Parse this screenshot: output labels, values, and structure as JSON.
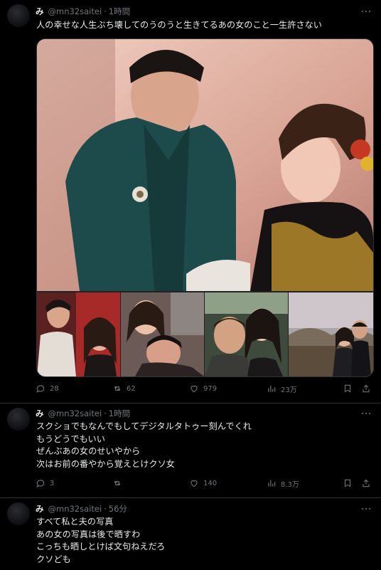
{
  "tweets": [
    {
      "name": "み",
      "handle": "@mn32saitei",
      "time": "1時間",
      "lines": [
        "人の幸せな人生ぶち壊してのうのうと生きてるあの女のこと一生許さない"
      ],
      "replies": "28",
      "retweets": "62",
      "likes": "979",
      "views": "23万"
    },
    {
      "name": "み",
      "handle": "@mn32saitei",
      "time": "1時間",
      "lines": [
        "スクショでもなんでもしてデジタルタトゥー刻んでくれ",
        "もうどうでもいい",
        "ぜんぶあの女のせいやから",
        "次はお前の番やから覚えとけクソ女"
      ],
      "replies": "3",
      "retweets": "",
      "likes": "140",
      "views": "8.3万"
    },
    {
      "name": "み",
      "handle": "@mn32saitei",
      "time": "56分",
      "lines": [
        "すべて私と夫の写真",
        "あの女の写真は後で晒すわ",
        "こっちも晒しとけば文句ねえだろ",
        "クソども"
      ]
    }
  ],
  "icons": {
    "reply": "reply-icon",
    "retweet": "retweet-icon",
    "like": "heart-icon",
    "views": "views-icon",
    "bookmark": "bookmark-icon",
    "share": "share-icon",
    "more": "more-icon"
  },
  "colors": {
    "background": "#000000",
    "text": "#e7e9ea",
    "muted": "#71767b",
    "divider": "#2f3336"
  }
}
